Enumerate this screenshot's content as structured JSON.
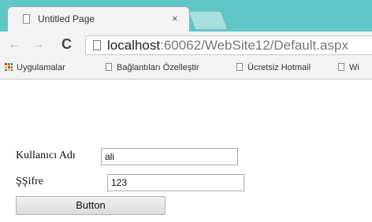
{
  "browser": {
    "tab": {
      "title": "Untitled Page",
      "close": "×"
    },
    "toolbar": {
      "back": "←",
      "forward": "→",
      "reload": "C",
      "url_host": "localhost",
      "url_rest": ":60062/WebSite12/Default.aspx"
    },
    "bookmarks": [
      {
        "label": "Uygulamalar",
        "icon": "apps-icon"
      },
      {
        "label": "Bağlantıları Özelleştir",
        "icon": "page-icon"
      },
      {
        "label": "Ücretsiz Hotmail",
        "icon": "page-icon"
      },
      {
        "label": "Wi",
        "icon": "page-icon"
      }
    ]
  },
  "form": {
    "username_label": "Kullanıcı Adı",
    "username_value": "ali",
    "password_label": "ŞŞifre",
    "password_value": "123",
    "button_label": "Button"
  }
}
